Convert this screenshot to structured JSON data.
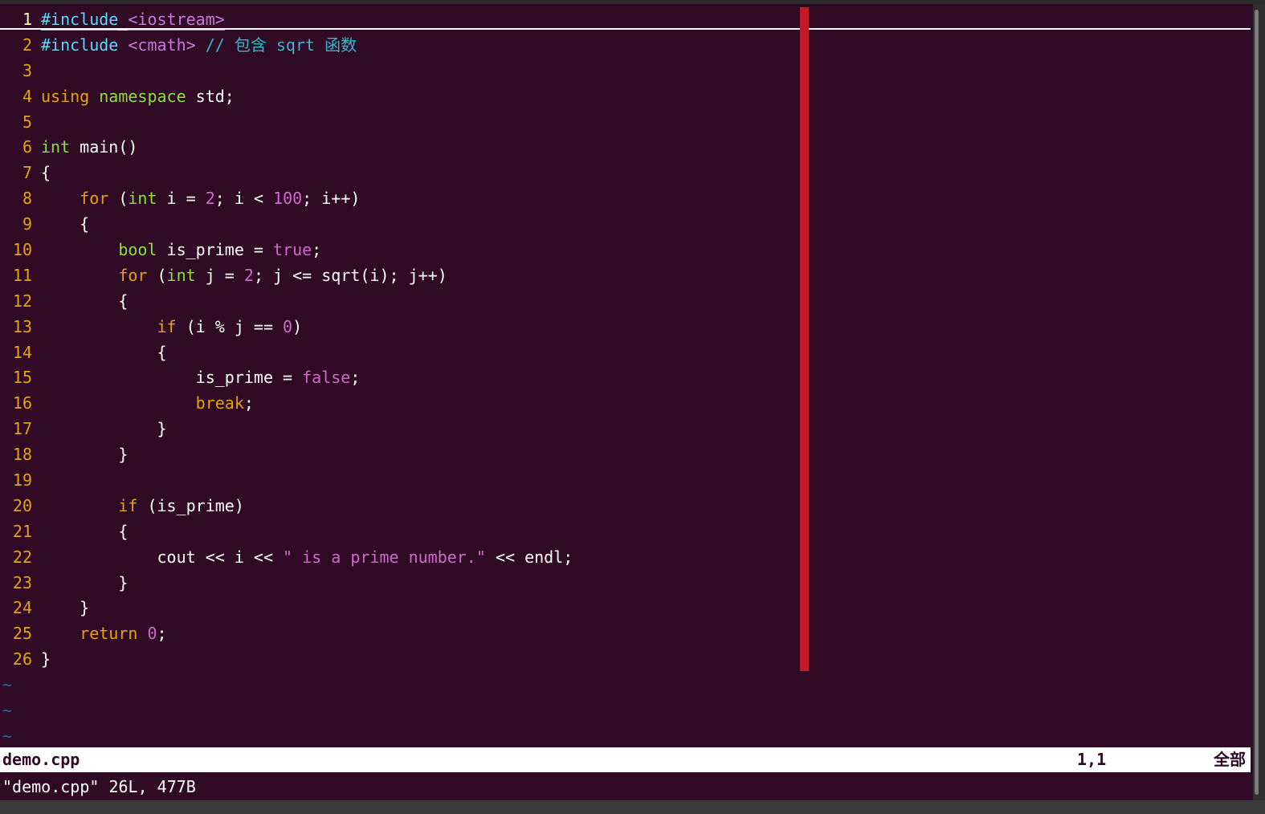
{
  "editor": {
    "lines": [
      {
        "number": "1",
        "tokens": [
          {
            "text": "#include",
            "class": "t-pre"
          },
          {
            "text": " ",
            "class": "t-txt"
          },
          {
            "text": "<iostream>",
            "class": "t-incl"
          }
        ]
      },
      {
        "number": "2",
        "tokens": [
          {
            "text": "#include",
            "class": "t-pre"
          },
          {
            "text": " ",
            "class": "t-txt"
          },
          {
            "text": "<cmath>",
            "class": "t-incl"
          },
          {
            "text": " // 包含 sqrt 函数",
            "class": "t-cmt"
          }
        ]
      },
      {
        "number": "3",
        "tokens": []
      },
      {
        "number": "4",
        "tokens": [
          {
            "text": "using",
            "class": "t-kw"
          },
          {
            "text": " ",
            "class": "t-txt"
          },
          {
            "text": "namespace",
            "class": "t-type"
          },
          {
            "text": " std;",
            "class": "t-txt"
          }
        ]
      },
      {
        "number": "5",
        "tokens": []
      },
      {
        "number": "6",
        "tokens": [
          {
            "text": "int",
            "class": "t-type"
          },
          {
            "text": " main()",
            "class": "t-txt"
          }
        ]
      },
      {
        "number": "7",
        "tokens": [
          {
            "text": "{",
            "class": "t-txt"
          }
        ]
      },
      {
        "number": "8",
        "tokens": [
          {
            "text": "    ",
            "class": "t-txt"
          },
          {
            "text": "for",
            "class": "t-kw"
          },
          {
            "text": " (",
            "class": "t-txt"
          },
          {
            "text": "int",
            "class": "t-type"
          },
          {
            "text": " i = ",
            "class": "t-txt"
          },
          {
            "text": "2",
            "class": "t-num"
          },
          {
            "text": "; i < ",
            "class": "t-txt"
          },
          {
            "text": "100",
            "class": "t-num"
          },
          {
            "text": "; i++)",
            "class": "t-txt"
          }
        ]
      },
      {
        "number": "9",
        "tokens": [
          {
            "text": "    {",
            "class": "t-txt"
          }
        ]
      },
      {
        "number": "10",
        "tokens": [
          {
            "text": "        ",
            "class": "t-txt"
          },
          {
            "text": "bool",
            "class": "t-type"
          },
          {
            "text": " is_prime = ",
            "class": "t-txt"
          },
          {
            "text": "true",
            "class": "t-bool"
          },
          {
            "text": ";",
            "class": "t-txt"
          }
        ]
      },
      {
        "number": "11",
        "tokens": [
          {
            "text": "        ",
            "class": "t-txt"
          },
          {
            "text": "for",
            "class": "t-kw"
          },
          {
            "text": " (",
            "class": "t-txt"
          },
          {
            "text": "int",
            "class": "t-type"
          },
          {
            "text": " j = ",
            "class": "t-txt"
          },
          {
            "text": "2",
            "class": "t-num"
          },
          {
            "text": "; j <= sqrt(i); j++)",
            "class": "t-txt"
          }
        ]
      },
      {
        "number": "12",
        "tokens": [
          {
            "text": "        {",
            "class": "t-txt"
          }
        ]
      },
      {
        "number": "13",
        "tokens": [
          {
            "text": "            ",
            "class": "t-txt"
          },
          {
            "text": "if",
            "class": "t-kw"
          },
          {
            "text": " (i % j == ",
            "class": "t-txt"
          },
          {
            "text": "0",
            "class": "t-num"
          },
          {
            "text": ")",
            "class": "t-txt"
          }
        ]
      },
      {
        "number": "14",
        "tokens": [
          {
            "text": "            {",
            "class": "t-txt"
          }
        ]
      },
      {
        "number": "15",
        "tokens": [
          {
            "text": "                is_prime = ",
            "class": "t-txt"
          },
          {
            "text": "false",
            "class": "t-bool"
          },
          {
            "text": ";",
            "class": "t-txt"
          }
        ]
      },
      {
        "number": "16",
        "tokens": [
          {
            "text": "                ",
            "class": "t-txt"
          },
          {
            "text": "break",
            "class": "t-kw"
          },
          {
            "text": ";",
            "class": "t-txt"
          }
        ]
      },
      {
        "number": "17",
        "tokens": [
          {
            "text": "            }",
            "class": "t-txt"
          }
        ]
      },
      {
        "number": "18",
        "tokens": [
          {
            "text": "        }",
            "class": "t-txt"
          }
        ]
      },
      {
        "number": "19",
        "tokens": []
      },
      {
        "number": "20",
        "tokens": [
          {
            "text": "        ",
            "class": "t-txt"
          },
          {
            "text": "if",
            "class": "t-kw"
          },
          {
            "text": " (is_prime)",
            "class": "t-txt"
          }
        ]
      },
      {
        "number": "21",
        "tokens": [
          {
            "text": "        {",
            "class": "t-txt"
          }
        ]
      },
      {
        "number": "22",
        "tokens": [
          {
            "text": "            cout << i << ",
            "class": "t-txt"
          },
          {
            "text": "\" is a prime number.\"",
            "class": "t-str"
          },
          {
            "text": " << endl;",
            "class": "t-txt"
          }
        ]
      },
      {
        "number": "23",
        "tokens": [
          {
            "text": "        }",
            "class": "t-txt"
          }
        ]
      },
      {
        "number": "24",
        "tokens": [
          {
            "text": "    }",
            "class": "t-txt"
          }
        ]
      },
      {
        "number": "25",
        "tokens": [
          {
            "text": "    ",
            "class": "t-txt"
          },
          {
            "text": "return",
            "class": "t-kw"
          },
          {
            "text": " ",
            "class": "t-txt"
          },
          {
            "text": "0",
            "class": "t-num"
          },
          {
            "text": ";",
            "class": "t-txt"
          }
        ]
      },
      {
        "number": "26",
        "tokens": [
          {
            "text": "}",
            "class": "t-txt"
          }
        ]
      }
    ],
    "cursor_line": 1,
    "tilde_lines": [
      "~",
      "~",
      "~"
    ]
  },
  "statusline": {
    "filename": "demo.cpp",
    "position": "1,1",
    "percent": "全部"
  },
  "cmdline": {
    "message": "\"demo.cpp\" 26L, 477B"
  },
  "colors": {
    "background": "#300a24",
    "line_number": "#e5a20f",
    "keyword": "#e5a20f",
    "type": "#8ae234",
    "preprocessor": "#5fd7ff",
    "constant": "#d167cf",
    "comment": "#34b7d0",
    "colorcolumn": "#c01c28"
  }
}
